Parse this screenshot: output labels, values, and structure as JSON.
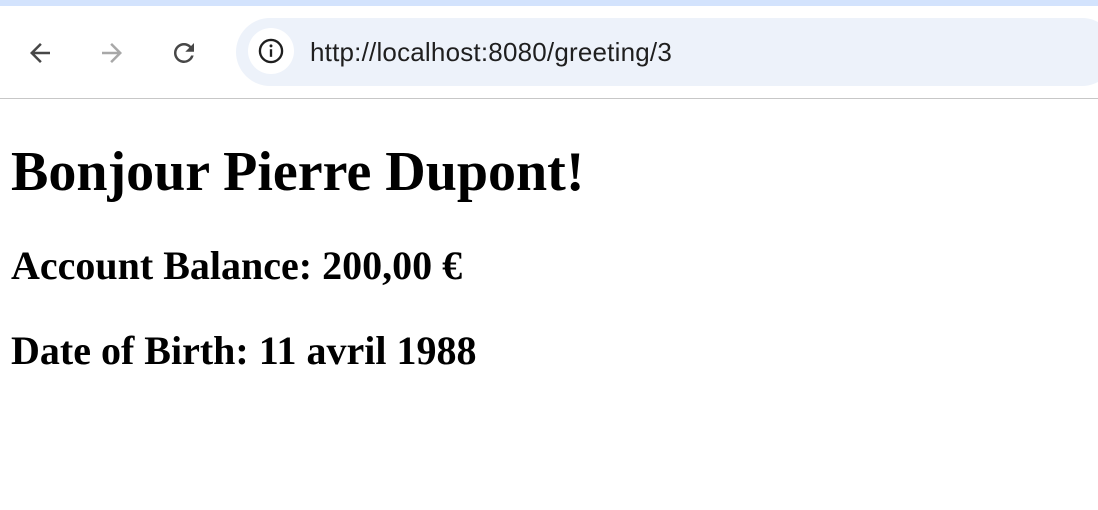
{
  "browser": {
    "url": "http://localhost:8080/greeting/3",
    "icons": {
      "back": "arrow-left-icon",
      "forward": "arrow-right-icon",
      "reload": "reload-icon",
      "site_info": "info-icon"
    },
    "colors": {
      "top_strip": "#d3e3fd",
      "omnibox": "#edf2fa",
      "forward_disabled": "#a8a8a8",
      "icon": "#474747"
    }
  },
  "page": {
    "heading": "Bonjour Pierre Dupont!",
    "balance": "Account Balance: 200,00 €",
    "dob": "Date of Birth: 11 avril 1988"
  }
}
